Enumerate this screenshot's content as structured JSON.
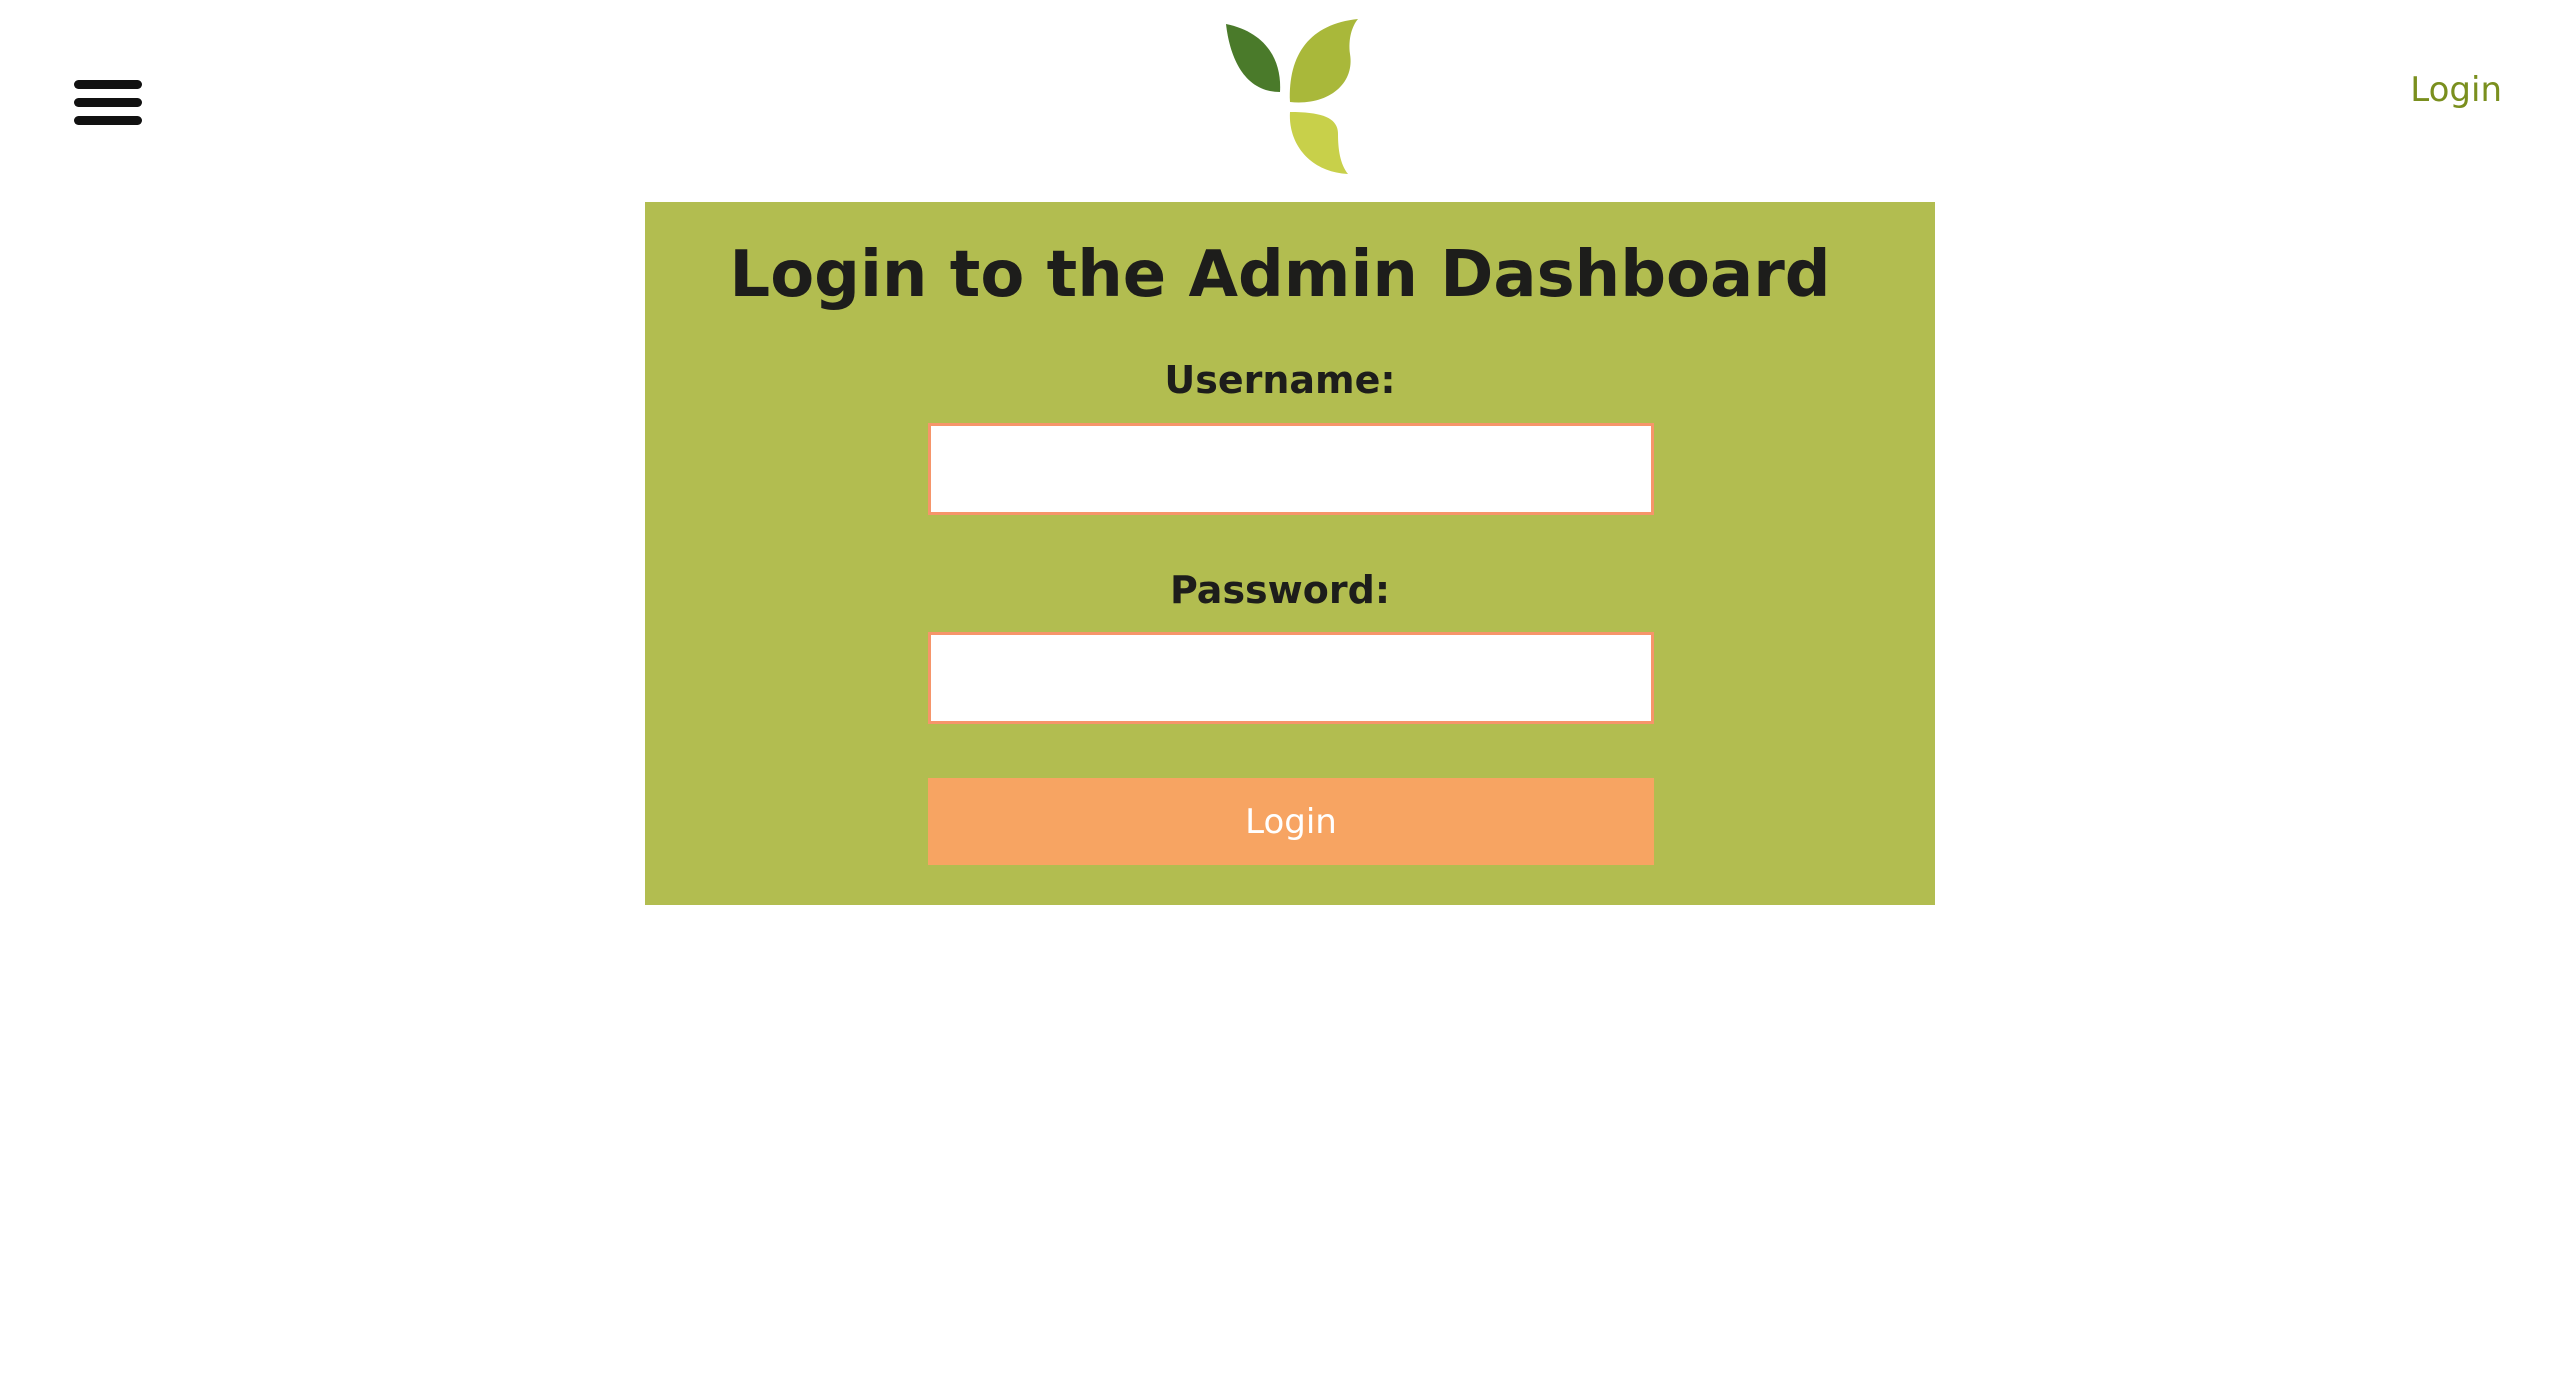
{
  "header": {
    "menu_icon": "hamburger-menu-icon",
    "logo_icon": "leaf-logo-icon",
    "nav_login_label": "Login"
  },
  "login_form": {
    "title": "Login to the Admin Dashboard",
    "username_label": "Username:",
    "username_value": "",
    "password_label": "Password:",
    "password_value": "",
    "submit_label": "Login"
  },
  "colors": {
    "panel_background": "#b2bd50",
    "button_background": "#f7a462",
    "input_border": "#f6956a",
    "nav_link": "#7a8f1e",
    "logo_dark_leaf": "#4a7a2a",
    "logo_mid_leaf": "#a9b83a",
    "logo_light_leaf": "#c8d04a"
  }
}
